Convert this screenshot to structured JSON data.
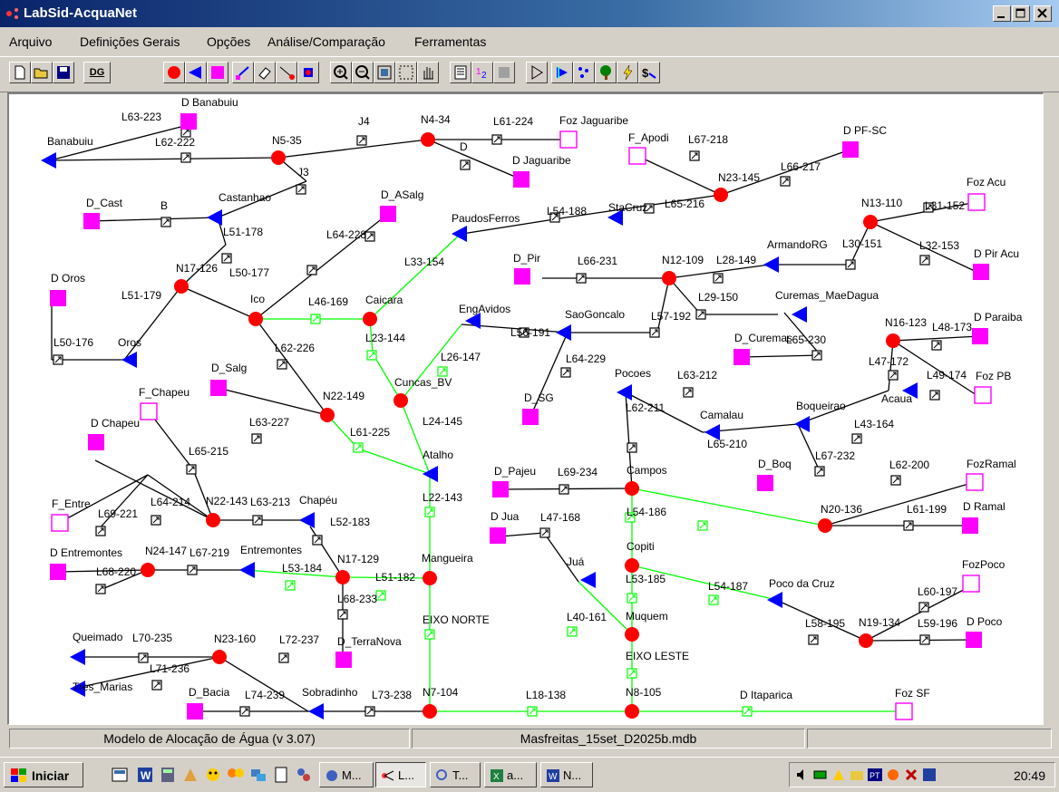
{
  "window": {
    "title": "LabSid-AcquaNet"
  },
  "menu": [
    "Arquivo",
    "Definições Gerais",
    "Opções",
    "Análise/Comparação",
    "Ferramentas"
  ],
  "toolbar": {
    "dg_label": "DG",
    "buttons": [
      "new-file-icon",
      "open-folder-icon",
      "save-icon",
      "dg-button",
      "node-tool-icon",
      "demand-arrow-icon",
      "reservoir-square-icon",
      "link-tool-icon",
      "eraser-icon",
      "select-link-icon",
      "move-node-icon",
      "zoom-in-icon",
      "zoom-out-icon",
      "zoom-fit-icon",
      "zoom-window-icon",
      "pan-hand-icon",
      "list-icon",
      "numbering-icon",
      "database-icon",
      "run-icon",
      "flag-icon",
      "scatter-icon",
      "tree-icon",
      "lightning-icon",
      "cost-icon"
    ]
  },
  "colors": {
    "node": "#ff0000",
    "demand": "#ff00ff",
    "arrow": "#0000ff",
    "green_link": "#00ff00",
    "black_link": "#000000"
  },
  "network": {
    "nodes": [
      {
        "id": "N5-35",
        "label": "N5-35"
      },
      {
        "id": "N4-34",
        "label": "N4-34"
      },
      {
        "id": "N23-145",
        "label": "N23-145"
      },
      {
        "id": "N13-110",
        "label": "N13-110"
      },
      {
        "id": "N17-126",
        "label": "N17-126"
      },
      {
        "id": "Ico",
        "label": "Ico"
      },
      {
        "id": "Caicara",
        "label": "Caicara"
      },
      {
        "id": "N12-109",
        "label": "N12-109"
      },
      {
        "id": "N16-123",
        "label": "N16-123"
      },
      {
        "id": "Cuncas_BV",
        "label": "Cuncas_BV"
      },
      {
        "id": "N22-149",
        "label": "N22-149"
      },
      {
        "id": "N22-143",
        "label": "N22-143"
      },
      {
        "id": "Campos",
        "label": "Campos"
      },
      {
        "id": "N20-136",
        "label": "N20-136"
      },
      {
        "id": "N24-147",
        "label": "N24-147"
      },
      {
        "id": "N17-129",
        "label": "N17-129"
      },
      {
        "id": "Mangueira",
        "label": "Mangueira"
      },
      {
        "id": "Copiti",
        "label": "Copiti"
      },
      {
        "id": "Muquem",
        "label": "Muquem"
      },
      {
        "id": "N19-134",
        "label": "N19-134"
      },
      {
        "id": "N23-160",
        "label": "N23-160"
      },
      {
        "id": "N7-104",
        "label": "N7-104"
      },
      {
        "id": "N8-105",
        "label": "N8-105"
      }
    ],
    "reservoirs": [
      "Banabuiu",
      "Castanhao",
      "Oros",
      "PaudosFerros",
      "StaCruz",
      "ArmandoRG",
      "Curemas_MaeDagua",
      "EngAvidos",
      "SaoGoncalo",
      "Pocoes",
      "Camalau",
      "Boqueirao",
      "Acaua",
      "Atalho",
      "Chapéu",
      "Entremontes",
      "Juá",
      "Poco da Cruz",
      "Queimado",
      "Tres_Marias",
      "Sobradinho"
    ],
    "demands": [
      "D Banabuiu",
      "D Jaguaribe",
      "D_Cast",
      "D_ASalg",
      "D PF-SC",
      "D Oros",
      "D_Pir",
      "D Pir Acu",
      "D Paraiba",
      "D_Curemas",
      "D_Salg",
      "D_SG",
      "D Chapeu",
      "D_Boq",
      "D_Pajeu",
      "D Jua",
      "D Entremontes",
      "D_TerraNova",
      "D Ramal",
      "D Poco",
      "D_Bacia"
    ],
    "sources": [
      "Foz Jaguaribe",
      "F_Apodi",
      "Foz Acu",
      "Foz PB",
      "F_Chapeu",
      "F_Entre",
      "FozRamal",
      "FozPoco",
      "Foz SF"
    ],
    "annotations": [
      "EIXO NORTE",
      "EIXO LESTE",
      "J3",
      "J4",
      "B",
      "D",
      "Castanhao",
      "StaCruz",
      "Ico",
      "Oros",
      "Atalho",
      "D Itaparica"
    ],
    "links": [
      "L63-223",
      "L62-222",
      "L61-224",
      "L67-218",
      "L66-217",
      "L65-216",
      "L54-188",
      "L31-152",
      "L30-151",
      "L32-153",
      "L51-178",
      "L64-228",
      "L33-154",
      "L66-231",
      "L28-149",
      "L29-150",
      "L50-177",
      "L51-179",
      "L46-169",
      "L57-192",
      "L56-191",
      "L23-144",
      "L26-147",
      "L64-229",
      "L65-230",
      "L48-173",
      "L47-172",
      "L49-174",
      "L50-176",
      "L62-226",
      "L63-212",
      "L43-164",
      "L24-145",
      "L63-227",
      "L61-225",
      "L62-211",
      "L65-210",
      "L67-232",
      "L65-215",
      "L69-234",
      "L62-200",
      "L64-214",
      "L63-213",
      "L22-143",
      "L54-186",
      "L61-199",
      "L69-221",
      "L52-183",
      "L47-168",
      "L67-219",
      "L68-220",
      "L53-184",
      "L51-182",
      "L53-185",
      "L54-187",
      "L60-197",
      "L68-233",
      "L40-161",
      "L58-195",
      "L59-196",
      "L70-235",
      "L72-237",
      "L71-236",
      "L74-239",
      "L73-238",
      "L18-138"
    ]
  },
  "status": {
    "model": "Modelo de Alocação de Água (v 3.07)",
    "file": "Masfreitas_15set_D2025b.mdb",
    "extra": ""
  },
  "taskbar": {
    "start": "Iniciar",
    "tasks": [
      {
        "label": "M...",
        "active": false
      },
      {
        "label": "L...",
        "active": true
      },
      {
        "label": "T...",
        "active": false
      },
      {
        "label": "a...",
        "active": false
      },
      {
        "label": "N...",
        "active": false
      }
    ],
    "clock": "20:49"
  }
}
